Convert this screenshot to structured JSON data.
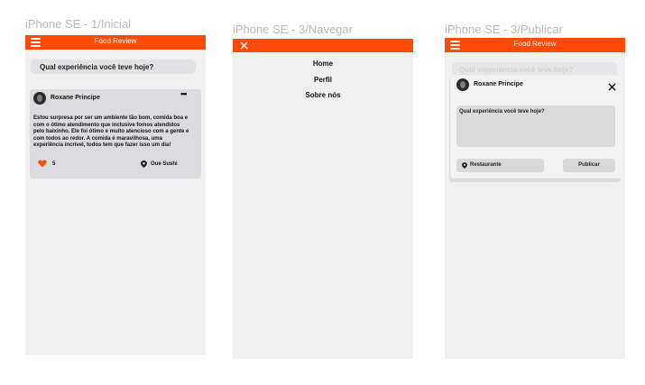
{
  "frames": {
    "inicial": {
      "title": "iPhone SE - 1/Inicial",
      "app_title": "Food Review",
      "composer_placeholder": "Qual experiência você teve hoje?",
      "post": {
        "user": "Roxane Principe",
        "text_lines": [
          "Estou surpresa por ser um ambiente tão bom, comida boa e",
          "com o ótimo atendimento que inclusive fomos atendidos",
          "pelo baixinho. Ele foi ótimo e muito atencioso com a gente e",
          "com todos ao redor. A comida é maravilhosa, uma",
          "experiência incrível, todos tem que fazer isso um dia!"
        ],
        "likes": "5",
        "place": "Oue Sushi"
      }
    },
    "navegar": {
      "title": "iPhone SE - 3/Navegar",
      "menu": [
        "Home",
        "Perfil",
        "Sobre nós"
      ]
    },
    "publicar": {
      "title": "iPhone SE - 3/Publicar",
      "app_title": "Food Review",
      "composer_placeholder": "Qual experiência você teve hoje?",
      "modal": {
        "user": "Roxane Principe",
        "field_placeholder": "Qual experiência você teve hoje?",
        "restaurant_label": "Restaurante",
        "publish_label": "Publicar"
      }
    }
  },
  "colors": {
    "accent": "#ff4a05",
    "heart": "#ff4a05",
    "frame_bg": "#f0f0f0",
    "card_bg": "#dcdcdf"
  },
  "icons": [
    "hamburger-icon",
    "more-dots-icon",
    "heart-icon",
    "location-pin-icon",
    "close-icon"
  ]
}
